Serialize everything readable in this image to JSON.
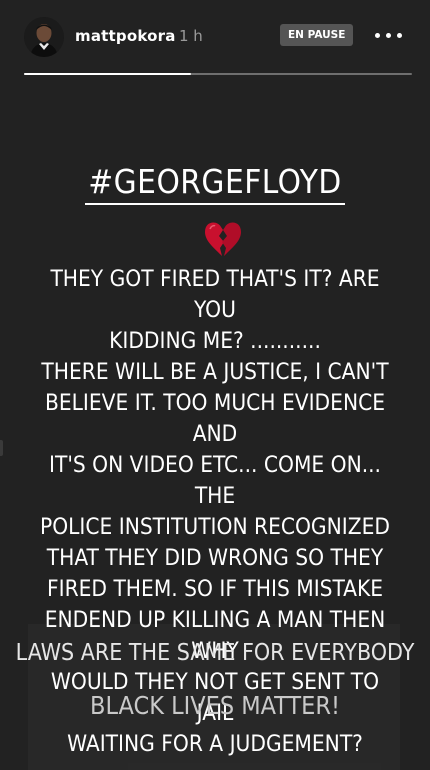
{
  "story": {
    "progress_fraction": 0.43
  },
  "header": {
    "username": "mattpokora",
    "timestamp": "1 h",
    "pause_badge": "EN PAUSE",
    "more_icon": "more-horizontal-icon"
  },
  "content": {
    "hashtag": "#GEORGEFLOYD",
    "emoji": "broken-heart-icon",
    "body_lines": [
      "THEY GOT FIRED THAT'S IT? ARE YOU",
      "KIDDING ME? ...........",
      "THERE WILL BE A JUSTICE, I CAN'T",
      "BELIEVE IT. TOO MUCH EVIDENCE AND",
      "IT'S ON VIDEO ETC... COME ON... THE",
      "POLICE INSTITUTION RECOGNIZED",
      "THAT THEY DID WRONG SO THEY",
      "FIRED THEM. SO IF THIS MISTAKE",
      "ENDEND UP KILLING A MAN THEN WHY",
      "WOULD THEY NOT GET SENT TO JAIL",
      "WAITING FOR A JUDGEMENT?"
    ],
    "laws_line": "LAWS ARE THE SAME FOR EVERYBODY",
    "blm_line": "BLACK LIVES MATTER!"
  },
  "colors": {
    "background": "#222222",
    "text": "#ffffff",
    "heart": "#c8102e",
    "badge": "#555555"
  }
}
